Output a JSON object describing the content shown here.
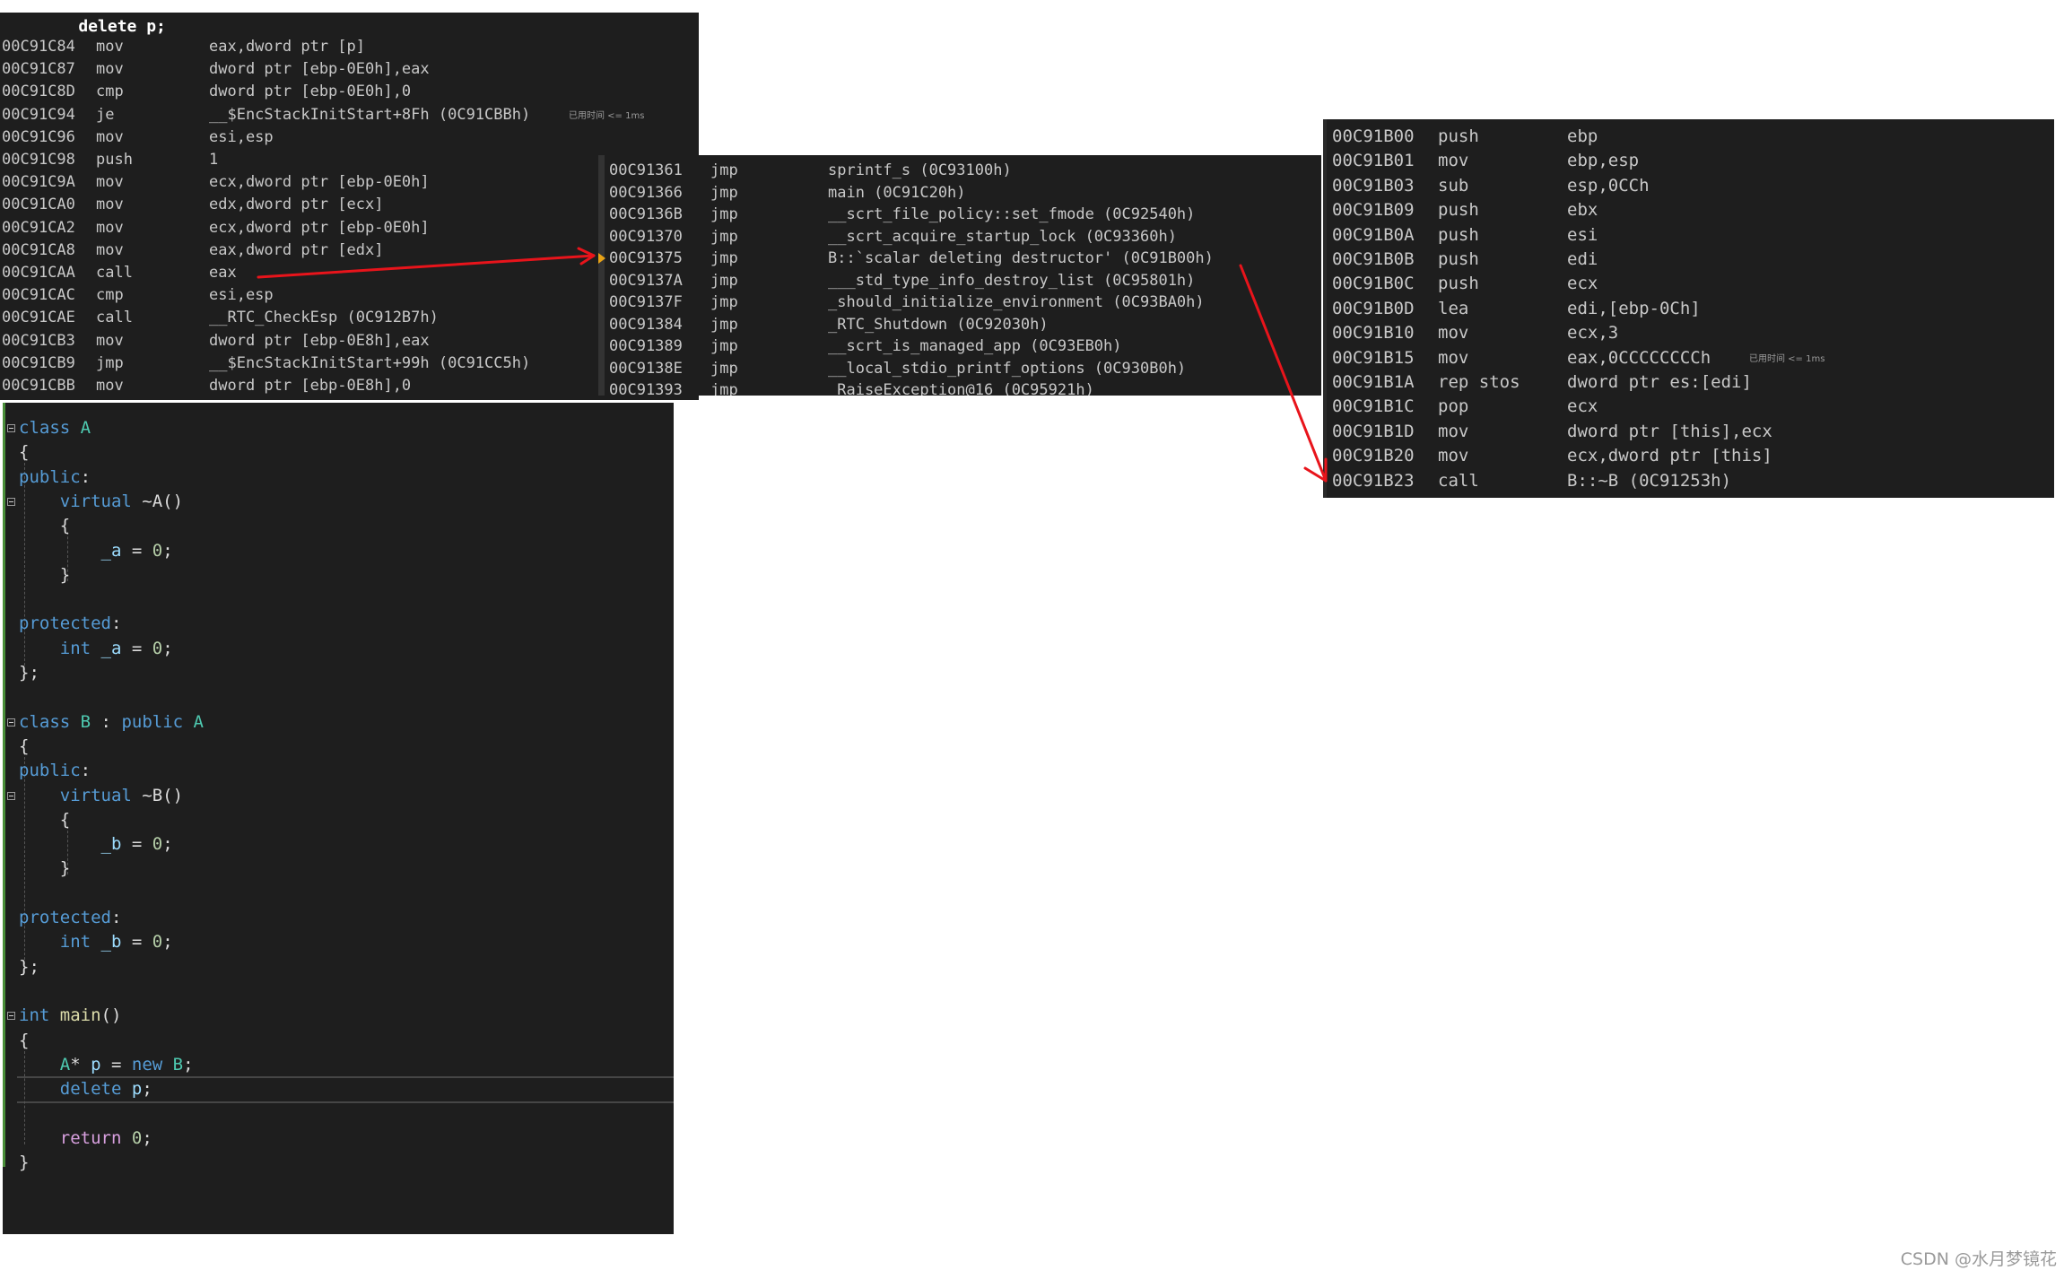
{
  "disasm_main": {
    "source_line": "    delete p;",
    "rows": [
      {
        "addr": "00C91C84",
        "op": "mov",
        "args": "eax,dword ptr [p]"
      },
      {
        "addr": "00C91C87",
        "op": "mov",
        "args": "dword ptr [ebp-0E0h],eax"
      },
      {
        "addr": "00C91C8D",
        "op": "cmp",
        "args": "dword ptr [ebp-0E0h],0"
      },
      {
        "addr": "00C91C94",
        "op": "je",
        "args": "__$EncStackInitStart+8Fh (0C91CBBh)",
        "hint": "已用时间 <= 1ms"
      },
      {
        "addr": "00C91C96",
        "op": "mov",
        "args": "esi,esp"
      },
      {
        "addr": "00C91C98",
        "op": "push",
        "args": "1"
      },
      {
        "addr": "00C91C9A",
        "op": "mov",
        "args": "ecx,dword ptr [ebp-0E0h]"
      },
      {
        "addr": "00C91CA0",
        "op": "mov",
        "args": "edx,dword ptr [ecx]"
      },
      {
        "addr": "00C91CA2",
        "op": "mov",
        "args": "ecx,dword ptr [ebp-0E0h]"
      },
      {
        "addr": "00C91CA8",
        "op": "mov",
        "args": "eax,dword ptr [edx]"
      },
      {
        "addr": "00C91CAA",
        "op": "call",
        "args": "eax"
      },
      {
        "addr": "00C91CAC",
        "op": "cmp",
        "args": "esi,esp"
      },
      {
        "addr": "00C91CAE",
        "op": "call",
        "args": "__RTC_CheckEsp (0C912B7h)"
      },
      {
        "addr": "00C91CB3",
        "op": "mov",
        "args": "dword ptr [ebp-0E8h],eax"
      },
      {
        "addr": "00C91CB9",
        "op": "jmp",
        "args": "__$EncStackInitStart+99h (0C91CC5h)"
      },
      {
        "addr": "00C91CBB",
        "op": "mov",
        "args": "dword ptr [ebp-0E8h],0"
      }
    ]
  },
  "disasm_thunks": {
    "rows": [
      {
        "addr": "00C91361",
        "op": "jmp",
        "args": "sprintf_s (0C93100h)"
      },
      {
        "addr": "00C91366",
        "op": "jmp",
        "args": "main (0C91C20h)"
      },
      {
        "addr": "00C9136B",
        "op": "jmp",
        "args": "__scrt_file_policy::set_fmode (0C92540h)"
      },
      {
        "addr": "00C91370",
        "op": "jmp",
        "args": "__scrt_acquire_startup_lock (0C93360h)"
      },
      {
        "addr": "00C91375",
        "op": "jmp",
        "args": "B::`scalar deleting destructor' (0C91B00h)",
        "current": true
      },
      {
        "addr": "00C9137A",
        "op": "jmp",
        "args": "___std_type_info_destroy_list (0C95801h)"
      },
      {
        "addr": "00C9137F",
        "op": "jmp",
        "args": "_should_initialize_environment (0C93BA0h)"
      },
      {
        "addr": "00C91384",
        "op": "jmp",
        "args": "_RTC_Shutdown (0C92030h)"
      },
      {
        "addr": "00C91389",
        "op": "jmp",
        "args": "__scrt_is_managed_app (0C93EB0h)"
      },
      {
        "addr": "00C9138E",
        "op": "jmp",
        "args": "__local_stdio_printf_options (0C930B0h)"
      },
      {
        "addr": "00C91393",
        "op": "jmp",
        "args": "_RaiseException@16 (0C95921h)"
      }
    ]
  },
  "disasm_destructor": {
    "rows": [
      {
        "addr": "00C91B00",
        "op": "push",
        "args": "ebp"
      },
      {
        "addr": "00C91B01",
        "op": "mov",
        "args": "ebp,esp"
      },
      {
        "addr": "00C91B03",
        "op": "sub",
        "args": "esp,0CCh"
      },
      {
        "addr": "00C91B09",
        "op": "push",
        "args": "ebx"
      },
      {
        "addr": "00C91B0A",
        "op": "push",
        "args": "esi"
      },
      {
        "addr": "00C91B0B",
        "op": "push",
        "args": "edi"
      },
      {
        "addr": "00C91B0C",
        "op": "push",
        "args": "ecx"
      },
      {
        "addr": "00C91B0D",
        "op": "lea",
        "args": "edi,[ebp-0Ch]"
      },
      {
        "addr": "00C91B10",
        "op": "mov",
        "args": "ecx,3"
      },
      {
        "addr": "00C91B15",
        "op": "mov",
        "args": "eax,0CCCCCCCCh",
        "hint": "已用时间 <= 1ms"
      },
      {
        "addr": "00C91B1A",
        "op": "rep stos",
        "args": "dword ptr es:[edi]"
      },
      {
        "addr": "00C91B1C",
        "op": "pop",
        "args": "ecx"
      },
      {
        "addr": "00C91B1D",
        "op": "mov",
        "args": "dword ptr [this],ecx"
      },
      {
        "addr": "00C91B20",
        "op": "mov",
        "args": "ecx,dword ptr [this]"
      },
      {
        "addr": "00C91B23",
        "op": "call",
        "args": "B::~B (0C91253h)"
      }
    ]
  },
  "source_code": {
    "lines": [
      [
        [
          "kw",
          "class"
        ],
        [
          "pl",
          " "
        ],
        [
          "ty",
          "A"
        ]
      ],
      [
        [
          "pl",
          "{"
        ]
      ],
      [
        [
          "kw",
          "public"
        ],
        [
          "pl",
          ":"
        ]
      ],
      [
        [
          "pl",
          "    "
        ],
        [
          "kw",
          "virtual"
        ],
        [
          "pl",
          " ~A()"
        ]
      ],
      [
        [
          "pl",
          "    {"
        ]
      ],
      [
        [
          "pl",
          "        "
        ],
        [
          "var",
          "_a"
        ],
        [
          "pl",
          " = "
        ],
        [
          "num",
          "0"
        ],
        [
          "pl",
          ";"
        ]
      ],
      [
        [
          "pl",
          "    }"
        ]
      ],
      [],
      [
        [
          "kw",
          "protected"
        ],
        [
          "pl",
          ":"
        ]
      ],
      [
        [
          "pl",
          "    "
        ],
        [
          "kw",
          "int"
        ],
        [
          "pl",
          " "
        ],
        [
          "var",
          "_a"
        ],
        [
          "pl",
          " = "
        ],
        [
          "num",
          "0"
        ],
        [
          "pl",
          ";"
        ]
      ],
      [
        [
          "pl",
          "};"
        ]
      ],
      [],
      [
        [
          "kw",
          "class"
        ],
        [
          "pl",
          " "
        ],
        [
          "ty",
          "B"
        ],
        [
          "pl",
          " : "
        ],
        [
          "kw",
          "public"
        ],
        [
          "pl",
          " "
        ],
        [
          "ty",
          "A"
        ]
      ],
      [
        [
          "pl",
          "{"
        ]
      ],
      [
        [
          "kw",
          "public"
        ],
        [
          "pl",
          ":"
        ]
      ],
      [
        [
          "pl",
          "    "
        ],
        [
          "kw",
          "virtual"
        ],
        [
          "pl",
          " ~B()"
        ]
      ],
      [
        [
          "pl",
          "    {"
        ]
      ],
      [
        [
          "pl",
          "        "
        ],
        [
          "var",
          "_b"
        ],
        [
          "pl",
          " = "
        ],
        [
          "num",
          "0"
        ],
        [
          "pl",
          ";"
        ]
      ],
      [
        [
          "pl",
          "    }"
        ]
      ],
      [],
      [
        [
          "kw",
          "protected"
        ],
        [
          "pl",
          ":"
        ]
      ],
      [
        [
          "pl",
          "    "
        ],
        [
          "kw",
          "int"
        ],
        [
          "pl",
          " "
        ],
        [
          "var",
          "_b"
        ],
        [
          "pl",
          " = "
        ],
        [
          "num",
          "0"
        ],
        [
          "pl",
          ";"
        ]
      ],
      [
        [
          "pl",
          "};"
        ]
      ],
      [],
      [
        [
          "kw",
          "int"
        ],
        [
          "pl",
          " "
        ],
        [
          "fn",
          "main"
        ],
        [
          "pl",
          "()"
        ]
      ],
      [
        [
          "pl",
          "{"
        ]
      ],
      [
        [
          "pl",
          "    "
        ],
        [
          "ty",
          "A"
        ],
        [
          "pl",
          "* "
        ],
        [
          "var",
          "p"
        ],
        [
          "pl",
          " = "
        ],
        [
          "kw",
          "new"
        ],
        [
          "pl",
          " "
        ],
        [
          "ty",
          "B"
        ],
        [
          "pl",
          ";"
        ]
      ],
      [
        [
          "pl",
          "    "
        ],
        [
          "kw",
          "delete"
        ],
        [
          "pl",
          " "
        ],
        [
          "var",
          "p"
        ],
        [
          "pl",
          ";"
        ]
      ],
      [],
      [
        [
          "pl",
          "    "
        ],
        [
          "ctl",
          "return"
        ],
        [
          "pl",
          " "
        ],
        [
          "num",
          "0"
        ],
        [
          "pl",
          ";"
        ]
      ],
      [
        [
          "pl",
          "}"
        ]
      ]
    ],
    "current_line_index": 27,
    "fold_markers": [
      0,
      3,
      12,
      15,
      24
    ]
  },
  "annotations": {
    "arrow_color": "#e8141b",
    "arrows": [
      {
        "from": "call eax in main disassembly",
        "to": "00C91375 jmp B::`scalar deleting destructor'"
      },
      {
        "from": "0C91B00h target",
        "to": "00C91B23 call B::~B"
      }
    ]
  },
  "watermark": "CSDN @水月梦镜花"
}
